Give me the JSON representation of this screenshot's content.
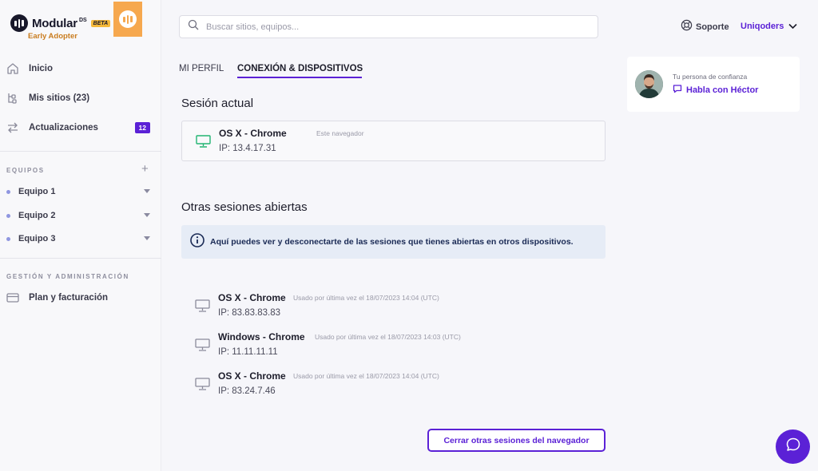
{
  "brand": {
    "name": "Modular",
    "ds": "DS",
    "beta": "BETA",
    "subtitle": "Early Adopter",
    "colors": {
      "accent": "#5b21d6",
      "orange": "#f6a84e",
      "green_device": "#22b573"
    }
  },
  "sidebar": {
    "items": [
      {
        "label": "Inicio",
        "icon": "home-icon"
      },
      {
        "label": "Mis sitios (23)",
        "icon": "sites-icon"
      },
      {
        "label": "Actualizaciones",
        "icon": "swap-arrows-icon",
        "count": "12"
      }
    ],
    "teams_title": "EQUIPOS",
    "teams": [
      {
        "label": "Equipo 1"
      },
      {
        "label": "Equipo 2"
      },
      {
        "label": "Equipo 3"
      }
    ],
    "admin_title": "GESTIÓN Y ADMINISTRACIÓN",
    "admin_items": [
      {
        "label": "Plan y facturación",
        "icon": "credit-card-icon"
      }
    ]
  },
  "header": {
    "search_placeholder": "Buscar sitios, equipos...",
    "support_label": "Soporte",
    "account_label": "Uniqoders"
  },
  "tabs": [
    {
      "label": "MI PERFIL",
      "active": false
    },
    {
      "label": "CONEXIÓN & DISPOSITIVOS",
      "active": true
    }
  ],
  "current_session": {
    "title": "Sesión actual",
    "device": "OS X - Chrome",
    "meta": "Este navegador",
    "ip": "IP: 13.4.17.31"
  },
  "other_sessions": {
    "title": "Otras sesiones abiertas",
    "info": "Aquí puedes ver y desconectarte de las sesiones que tienes abiertas en otros dispositivos.",
    "items": [
      {
        "device": "OS X - Chrome",
        "meta": "Usado por última vez el 18/07/2023 14:04 (UTC)",
        "ip": "IP: 83.83.83.83"
      },
      {
        "device": "Windows - Chrome",
        "meta": "Usado por última vez el 18/07/2023 14:03 (UTC)",
        "ip": "IP: 11.11.11.11"
      },
      {
        "device": "OS X - Chrome",
        "meta": "Usado por última vez el 18/07/2023 14:04 (UTC)",
        "ip": "IP: 83.24.7.46"
      }
    ],
    "close_button": "Cerrar otras sesiones del navegador"
  },
  "trust": {
    "label": "Tu persona de confianza",
    "link": "Habla con Héctor"
  }
}
